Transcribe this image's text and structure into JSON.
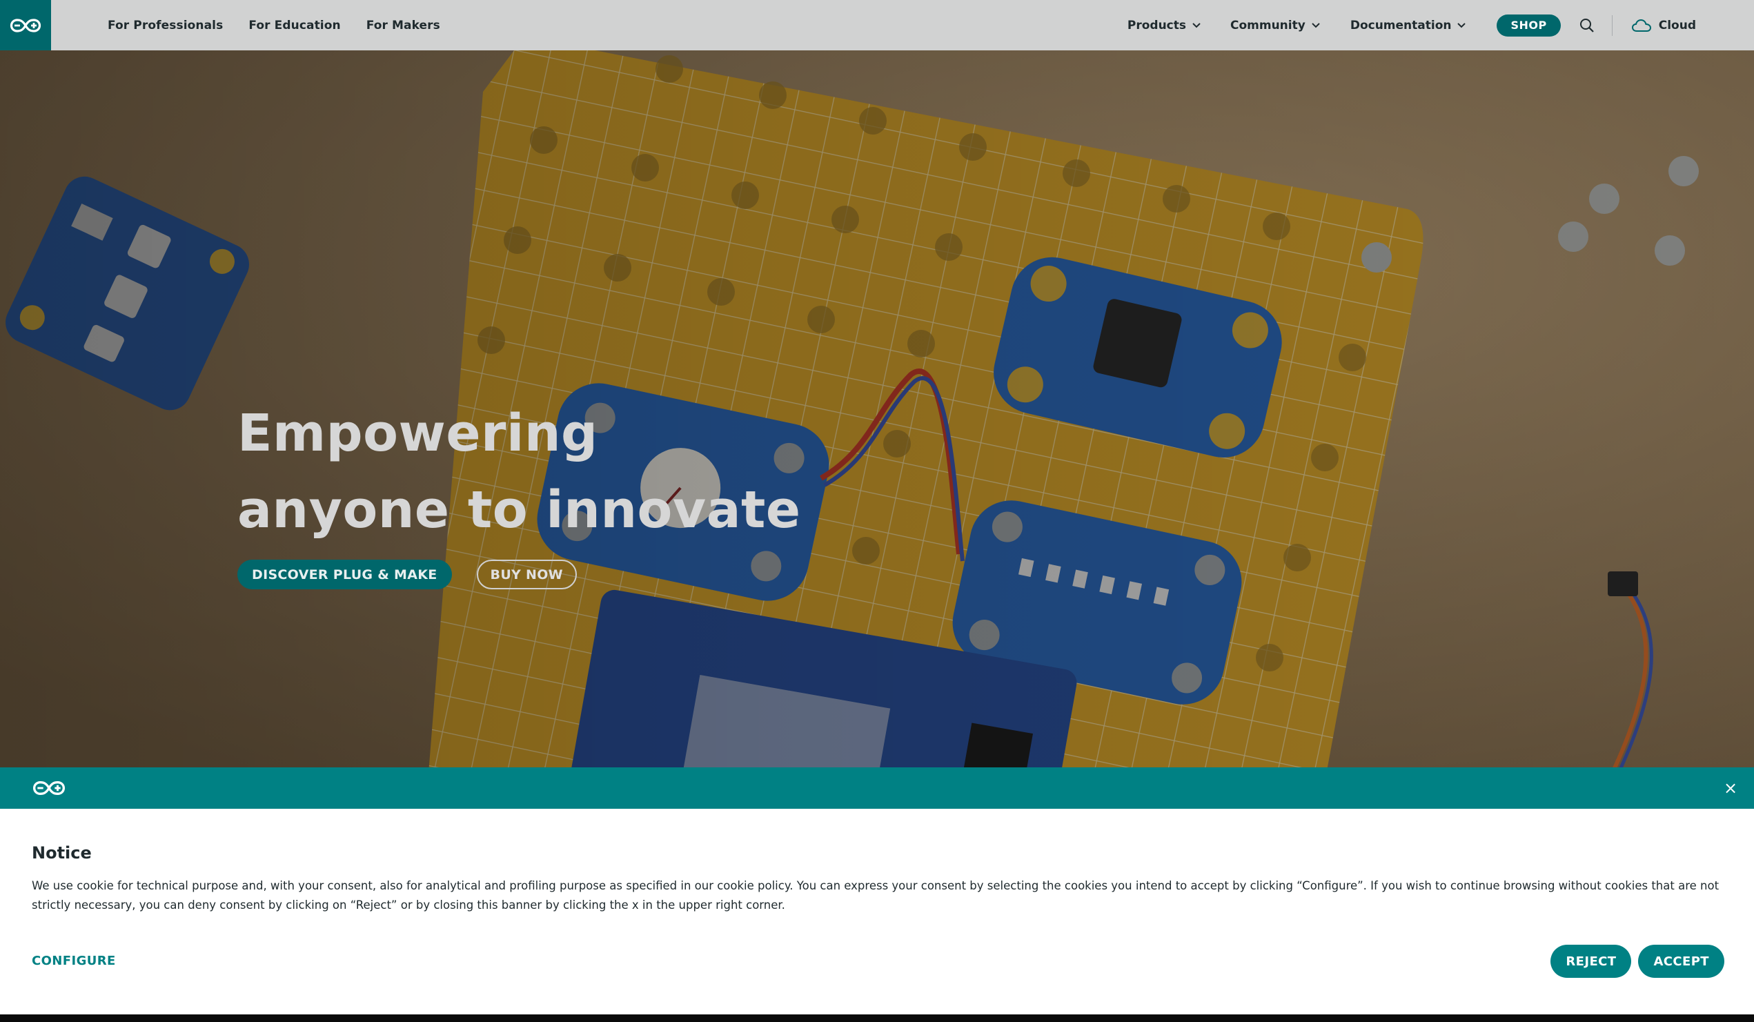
{
  "nav": {
    "left_links": [
      "For Professionals",
      "For Education",
      "For Makers"
    ],
    "dropdowns": [
      "Products",
      "Community",
      "Documentation"
    ],
    "shop_label": "SHOP",
    "cloud_label": "Cloud",
    "brand_color": "#00676b"
  },
  "hero": {
    "title_line1": "Empowering",
    "title_line2": "anyone to innovate",
    "primary_button": "DISCOVER PLUG & MAKE",
    "secondary_button": "BUY NOW"
  },
  "cookie": {
    "accent_color": "#008184",
    "close_glyph": "×",
    "title": "Notice",
    "text": "We use cookie for technical purpose and, with your consent, also for analytical and profiling purpose as specified in our cookie policy. You can express your consent by selecting the cookies you intend to accept by clicking “Configure”. If you wish to continue browsing without cookies that are not strictly necessary, you can deny consent by clicking on “Reject” or by closing this banner by clicking the x in the upper right corner.",
    "configure_label": "CONFIGURE",
    "reject_label": "REJECT",
    "accept_label": "ACCEPT"
  },
  "icons": [
    "arduino-logo-icon",
    "chevron-down-icon",
    "search-icon",
    "cloud-icon",
    "close-icon"
  ]
}
